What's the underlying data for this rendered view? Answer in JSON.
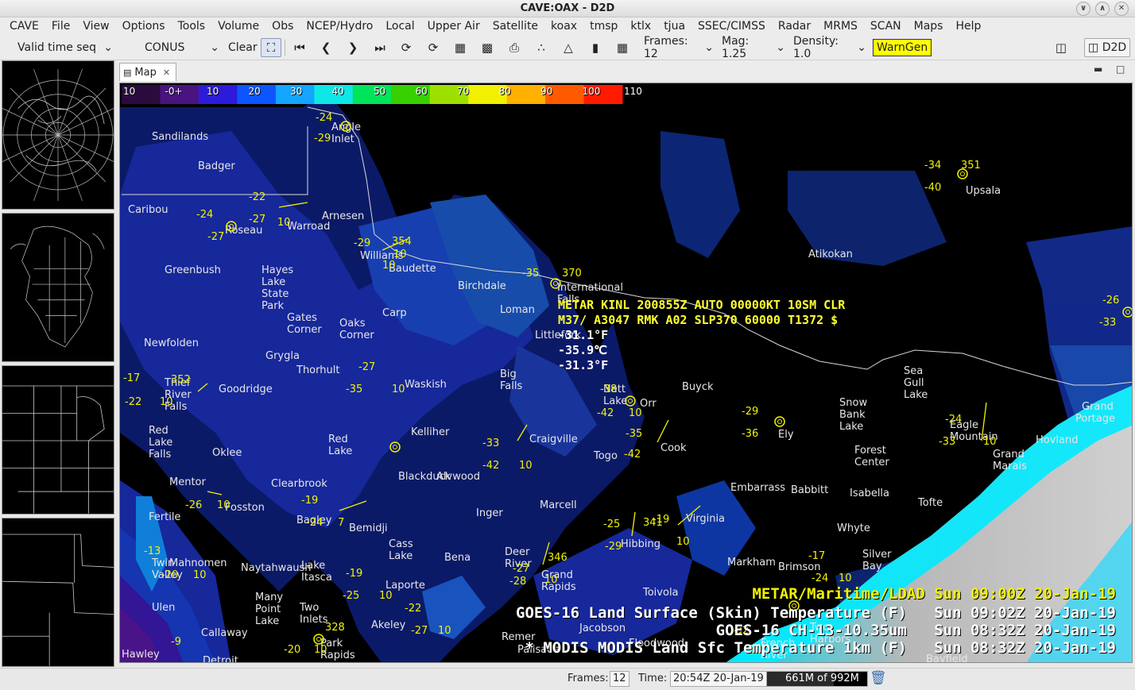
{
  "window": {
    "title": "CAVE:OAX - D2D"
  },
  "menu": [
    "CAVE",
    "File",
    "View",
    "Options",
    "Tools",
    "Volume",
    "Obs",
    "NCEP/Hydro",
    "Local",
    "Upper Air",
    "Satellite",
    "koax",
    "tmsp",
    "ktlx",
    "tjua",
    "SSEC/CIMSS",
    "Radar",
    "MRMS",
    "SCAN",
    "Maps",
    "Help"
  ],
  "toolbar": {
    "loop_mode": "Valid time seq",
    "scale": "CONUS",
    "clear": "Clear",
    "frames": "Frames: 12",
    "mag": "Mag: 1.25",
    "density": "Density: 1.0",
    "warngen": "WarnGen",
    "d2d": "D2D"
  },
  "tab": {
    "label": "Map"
  },
  "colorbar": {
    "labels": [
      "10",
      "-0+",
      "10",
      "20",
      "30",
      "40",
      "50",
      "60",
      "70",
      "80",
      "90",
      "100",
      "110"
    ],
    "colors": [
      "#2b0b3d",
      "#4a1380",
      "#2c1bd8",
      "#0c55ff",
      "#13a5ff",
      "#0ee7e7",
      "#00e45a",
      "#37d000",
      "#9de000",
      "#f0f000",
      "#ffb000",
      "#ff5a00",
      "#ff1a00"
    ]
  },
  "metar": {
    "line1": "METAR KINL 200855Z AUTO 00000KT 10SM CLR",
    "line2": "M37/ A3047 RMK A02 SLP370 60000 T1372 $",
    "temp": "-31.1°F",
    "dew": "-35.9℃",
    "wc": "-31.3°F"
  },
  "legend": {
    "metar": "METAR/Maritime/LDAD Sun 09:00Z 20-Jan-19",
    "goes_lst": "GOES-16 Land Surface (Skin) Temperature (F)   Sun 09:02Z 20-Jan-19",
    "goes_ch13": "GOES-16 CH-13-10.35um   Sun 08:32Z 20-Jan-19",
    "modis": "* MODIS MODIS Land Sfc Temperature 1km (F)   Sun 08:32Z 20-Jan-19"
  },
  "places": [
    {
      "t": "Sandilands"
    },
    {
      "t": "Badger"
    },
    {
      "t": "Caribou"
    },
    {
      "t": "Arnesen"
    },
    {
      "t": "Warroad"
    },
    {
      "t": "Roseau"
    },
    {
      "t": "Williams"
    },
    {
      "t": "Baudette"
    },
    {
      "t": "Greenbush"
    },
    {
      "t": "Hayes"
    },
    {
      "t": "Lake"
    },
    {
      "t": "State"
    },
    {
      "t": "Park"
    },
    {
      "t": "Birchdale"
    },
    {
      "t": "International"
    },
    {
      "t": "Falls"
    },
    {
      "t": "Loman"
    },
    {
      "t": "Carp"
    },
    {
      "t": "Gates"
    },
    {
      "t": "Corner"
    },
    {
      "t": "Oaks"
    },
    {
      "t": "Corner"
    },
    {
      "t": "Littlefork"
    },
    {
      "t": "Newfolden"
    },
    {
      "t": "Grygla"
    },
    {
      "t": "Thorhult"
    },
    {
      "t": "Big"
    },
    {
      "t": "Falls"
    },
    {
      "t": "Waskish"
    },
    {
      "t": "Goodridge"
    },
    {
      "t": "Thief"
    },
    {
      "t": "River"
    },
    {
      "t": "Falls"
    },
    {
      "t": "Nett"
    },
    {
      "t": "Lake"
    },
    {
      "t": "Orr"
    },
    {
      "t": "Buyck"
    },
    {
      "t": "Kelliher"
    },
    {
      "t": "Craigville"
    },
    {
      "t": "Red"
    },
    {
      "t": "Lake"
    },
    {
      "t": "Red"
    },
    {
      "t": "Lake"
    },
    {
      "t": "Falls"
    },
    {
      "t": "Oklee"
    },
    {
      "t": "Togo"
    },
    {
      "t": "Cook"
    },
    {
      "t": "Ely"
    },
    {
      "t": "Snow"
    },
    {
      "t": "Bank"
    },
    {
      "t": "Lake"
    },
    {
      "t": "Forest"
    },
    {
      "t": "Center"
    },
    {
      "t": "Sea"
    },
    {
      "t": "Gull"
    },
    {
      "t": "Lake"
    },
    {
      "t": "Eagle"
    },
    {
      "t": "Mountain"
    },
    {
      "t": "Hovland"
    },
    {
      "t": "Grand"
    },
    {
      "t": "Portage"
    },
    {
      "t": "Grand"
    },
    {
      "t": "Marais"
    },
    {
      "t": "Atikokan"
    },
    {
      "t": "Upsala"
    },
    {
      "t": "Blackduck"
    },
    {
      "t": "Alvwood"
    },
    {
      "t": "Mentor"
    },
    {
      "t": "Clearbrook"
    },
    {
      "t": "Embarrass"
    },
    {
      "t": "Babbitt"
    },
    {
      "t": "Isabella"
    },
    {
      "t": "Tofte"
    },
    {
      "t": "Marcell"
    },
    {
      "t": "Inger"
    },
    {
      "t": "Fertile"
    },
    {
      "t": "Fosston"
    },
    {
      "t": "Bagley"
    },
    {
      "t": "Bemidji"
    },
    {
      "t": "Virginia"
    },
    {
      "t": "Whyte"
    },
    {
      "t": "Hibbing"
    },
    {
      "t": "Cass"
    },
    {
      "t": "Lake"
    },
    {
      "t": "Bena"
    },
    {
      "t": "Deer"
    },
    {
      "t": "River"
    },
    {
      "t": "Grand"
    },
    {
      "t": "Rapids"
    },
    {
      "t": "Markham"
    },
    {
      "t": "Brimson"
    },
    {
      "t": "Silver"
    },
    {
      "t": "Bay"
    },
    {
      "t": "Mahnomen"
    },
    {
      "t": "Naytahwaush"
    },
    {
      "t": "Twin"
    },
    {
      "t": "Valley"
    },
    {
      "t": "Lake"
    },
    {
      "t": "Itasca"
    },
    {
      "t": "Laporte"
    },
    {
      "t": "Toivola"
    },
    {
      "t": "Ulen"
    },
    {
      "t": "Many"
    },
    {
      "t": "Point"
    },
    {
      "t": "Lake"
    },
    {
      "t": "Two"
    },
    {
      "t": "Inlets"
    },
    {
      "t": "Akeley"
    },
    {
      "t": "Jacobson"
    },
    {
      "t": "Floodwood"
    },
    {
      "t": "Callaway"
    },
    {
      "t": "Park"
    },
    {
      "t": "Rapids"
    },
    {
      "t": "Hawley"
    },
    {
      "t": "Detroit"
    },
    {
      "t": "Palisade"
    },
    {
      "t": "Remer"
    },
    {
      "t": "Angle"
    },
    {
      "t": "Inlet"
    },
    {
      "t": "French"
    },
    {
      "t": "River"
    },
    {
      "t": "Bayfield"
    },
    {
      "t": "Two"
    },
    {
      "t": "Harbors"
    }
  ],
  "obs_values": [
    {
      "t": "-24"
    },
    {
      "t": "-29"
    },
    {
      "t": "-22"
    },
    {
      "t": "-24"
    },
    {
      "t": "-27"
    },
    {
      "t": "-27"
    },
    {
      "t": "10"
    },
    {
      "t": "-29"
    },
    {
      "t": "354"
    },
    {
      "t": "10"
    },
    {
      "t": "10"
    },
    {
      "t": "-35"
    },
    {
      "t": "370"
    },
    {
      "t": "-27"
    },
    {
      "t": "-35"
    },
    {
      "t": "10"
    },
    {
      "t": "-17"
    },
    {
      "t": "352"
    },
    {
      "t": "-22"
    },
    {
      "t": "10"
    },
    {
      "t": "-38"
    },
    {
      "t": "-42"
    },
    {
      "t": "10"
    },
    {
      "t": "-35"
    },
    {
      "t": "-29"
    },
    {
      "t": "-36"
    },
    {
      "t": "-34"
    },
    {
      "t": "351"
    },
    {
      "t": "-40"
    },
    {
      "t": "-24"
    },
    {
      "t": "-33"
    },
    {
      "t": "10"
    },
    {
      "t": "-33"
    },
    {
      "t": "-42"
    },
    {
      "t": "10"
    },
    {
      "t": "-42"
    },
    {
      "t": "-26"
    },
    {
      "t": "-33"
    },
    {
      "t": "-26"
    },
    {
      "t": "10"
    },
    {
      "t": "-19"
    },
    {
      "t": "-24"
    },
    {
      "t": "7"
    },
    {
      "t": "-25"
    },
    {
      "t": "341"
    },
    {
      "t": "-19"
    },
    {
      "t": "-29"
    },
    {
      "t": "10"
    },
    {
      "t": "-13"
    },
    {
      "t": "-20"
    },
    {
      "t": "10"
    },
    {
      "t": "-19"
    },
    {
      "t": "-25"
    },
    {
      "t": "10"
    },
    {
      "t": "346"
    },
    {
      "t": "-27"
    },
    {
      "t": "-28"
    },
    {
      "t": "10"
    },
    {
      "t": "-17"
    },
    {
      "t": "-24"
    },
    {
      "t": "10"
    },
    {
      "t": "-22"
    },
    {
      "t": "-27"
    },
    {
      "t": "10"
    },
    {
      "t": "328"
    },
    {
      "t": "-20"
    },
    {
      "t": "10"
    },
    {
      "t": "-9"
    },
    {
      "t": "-26"
    },
    {
      "t": "10"
    },
    {
      "t": "-32"
    },
    {
      "t": "-20"
    }
  ],
  "status": {
    "frames_label": "Frames:",
    "frames_value": "12",
    "time_label": "Time:",
    "time_value": "20:54Z 20-Jan-19",
    "memory": "661M of 992M",
    "memory_fraction": 0.666
  }
}
